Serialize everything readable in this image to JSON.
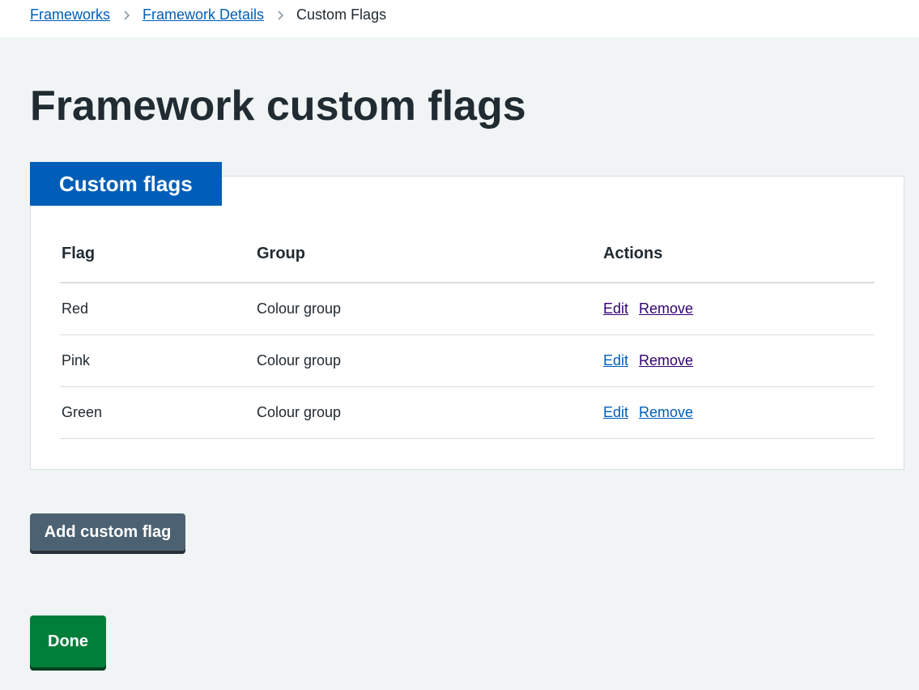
{
  "breadcrumb": {
    "items": [
      {
        "label": "Frameworks",
        "link": true
      },
      {
        "label": "Framework Details",
        "link": true
      },
      {
        "label": "Custom Flags",
        "link": false
      }
    ]
  },
  "page": {
    "title": "Framework custom flags"
  },
  "card": {
    "heading": "Custom flags",
    "table": {
      "headers": [
        "Flag",
        "Group",
        "Actions"
      ],
      "rows": [
        {
          "flag": "Red",
          "group": "Colour group",
          "edit": "Edit",
          "remove": "Remove"
        },
        {
          "flag": "Pink",
          "group": "Colour group",
          "edit": "Edit",
          "remove": "Remove"
        },
        {
          "flag": "Green",
          "group": "Colour group",
          "edit": "Edit",
          "remove": "Remove"
        }
      ]
    }
  },
  "buttons": {
    "add_custom_flag": "Add custom flag",
    "done": "Done"
  },
  "colors": {
    "accent_blue": "#005eb8",
    "done_green": "#007f3b",
    "secondary_grey": "#4c6272",
    "visited_link": "#330072"
  },
  "icons": {
    "breadcrumb_separator": "chevron-right-icon"
  }
}
